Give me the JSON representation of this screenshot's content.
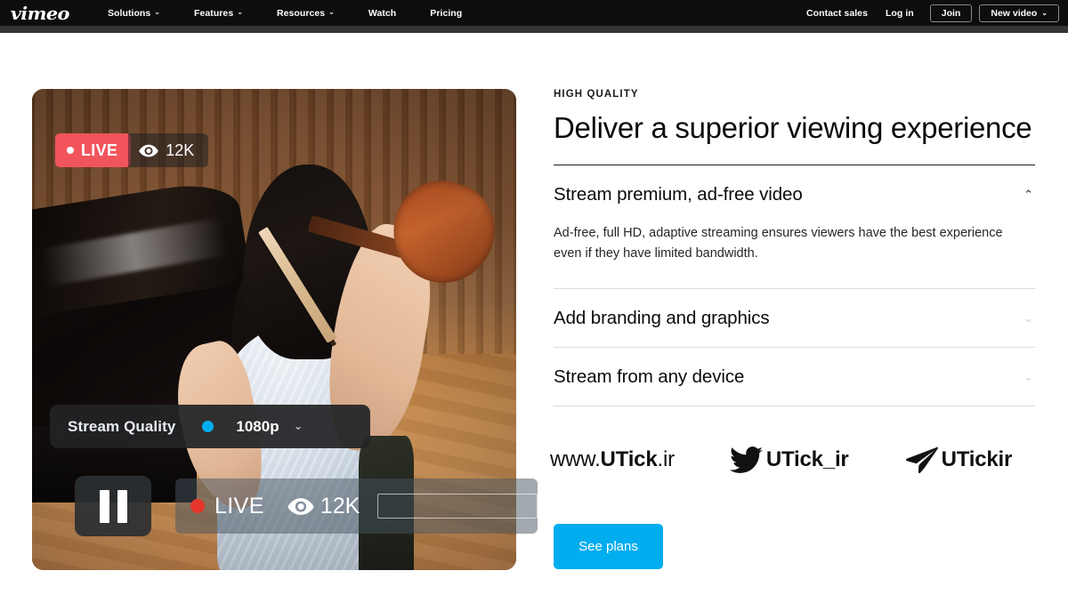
{
  "navbar": {
    "logo": "vimeo",
    "links": [
      {
        "label": "Solutions",
        "has_dropdown": true
      },
      {
        "label": "Features",
        "has_dropdown": true
      },
      {
        "label": "Resources",
        "has_dropdown": true
      },
      {
        "label": "Watch",
        "has_dropdown": false
      },
      {
        "label": "Pricing",
        "has_dropdown": false
      }
    ],
    "contact_sales": "Contact sales",
    "log_in": "Log in",
    "join": "Join",
    "new_video": "New video",
    "chevron": "⌄",
    "background": "#0d0d0d"
  },
  "player": {
    "live_label": "LIVE",
    "viewers": "12K",
    "live_badge_color": "#f2545b",
    "quality": {
      "label": "Stream Quality",
      "value": "1080p",
      "dot_color": "#00adef",
      "chevron": "⌄"
    },
    "controls": {
      "live_label": "LIVE",
      "viewers": "12K",
      "record_dot_color": "#e5352b"
    }
  },
  "content": {
    "eyebrow": "HIGH QUALITY",
    "headline": "Deliver a superior viewing experience",
    "accordion": [
      {
        "title": "Stream premium, ad-free video",
        "body": "Ad-free, full HD, adaptive streaming ensures viewers have the best experience even if they have limited bandwidth.",
        "expanded": true,
        "chevron": "⌃"
      },
      {
        "title": "Add branding and graphics",
        "body": "",
        "expanded": false,
        "chevron": "⌄"
      },
      {
        "title": "Stream from any device",
        "body": "",
        "expanded": false,
        "chevron": "⌄"
      }
    ],
    "cta": "See plans",
    "cta_color": "#00adef"
  },
  "watermark": {
    "site_prefix": "www.",
    "site_name": "UTick",
    "site_suffix": ".ir",
    "twitter_handle": "UTick_ir",
    "telegram_handle": "UTickir"
  }
}
